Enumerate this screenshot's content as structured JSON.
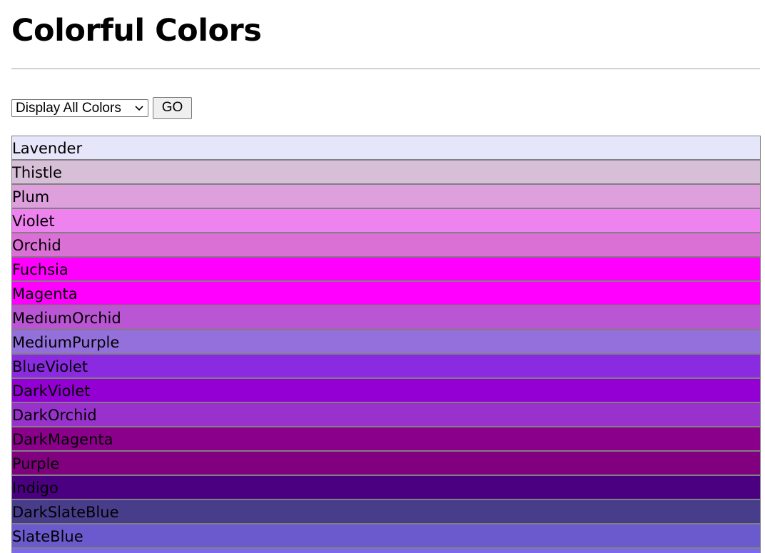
{
  "page": {
    "title": "Colorful Colors"
  },
  "controls": {
    "select_value": "Display All Colors",
    "go_label": "GO"
  },
  "colors": [
    {
      "name": "Lavender",
      "hex": "#E6E6FA"
    },
    {
      "name": "Thistle",
      "hex": "#D8BFD8"
    },
    {
      "name": "Plum",
      "hex": "#DDA0DD"
    },
    {
      "name": "Violet",
      "hex": "#EE82EE"
    },
    {
      "name": "Orchid",
      "hex": "#DA70D6"
    },
    {
      "name": "Fuchsia",
      "hex": "#FF00FF"
    },
    {
      "name": "Magenta",
      "hex": "#FF00FF"
    },
    {
      "name": "MediumOrchid",
      "hex": "#BA55D3"
    },
    {
      "name": "MediumPurple",
      "hex": "#9370DB"
    },
    {
      "name": "BlueViolet",
      "hex": "#8A2BE2"
    },
    {
      "name": "DarkViolet",
      "hex": "#9400D3"
    },
    {
      "name": "DarkOrchid",
      "hex": "#9932CC"
    },
    {
      "name": "DarkMagenta",
      "hex": "#8B008B"
    },
    {
      "name": "Purple",
      "hex": "#800080"
    },
    {
      "name": "Indigo",
      "hex": "#4B0082"
    },
    {
      "name": "DarkSlateBlue",
      "hex": "#483D8B"
    },
    {
      "name": "SlateBlue",
      "hex": "#6A5ACD"
    },
    {
      "name": "",
      "hex": "#7B68EE"
    }
  ]
}
